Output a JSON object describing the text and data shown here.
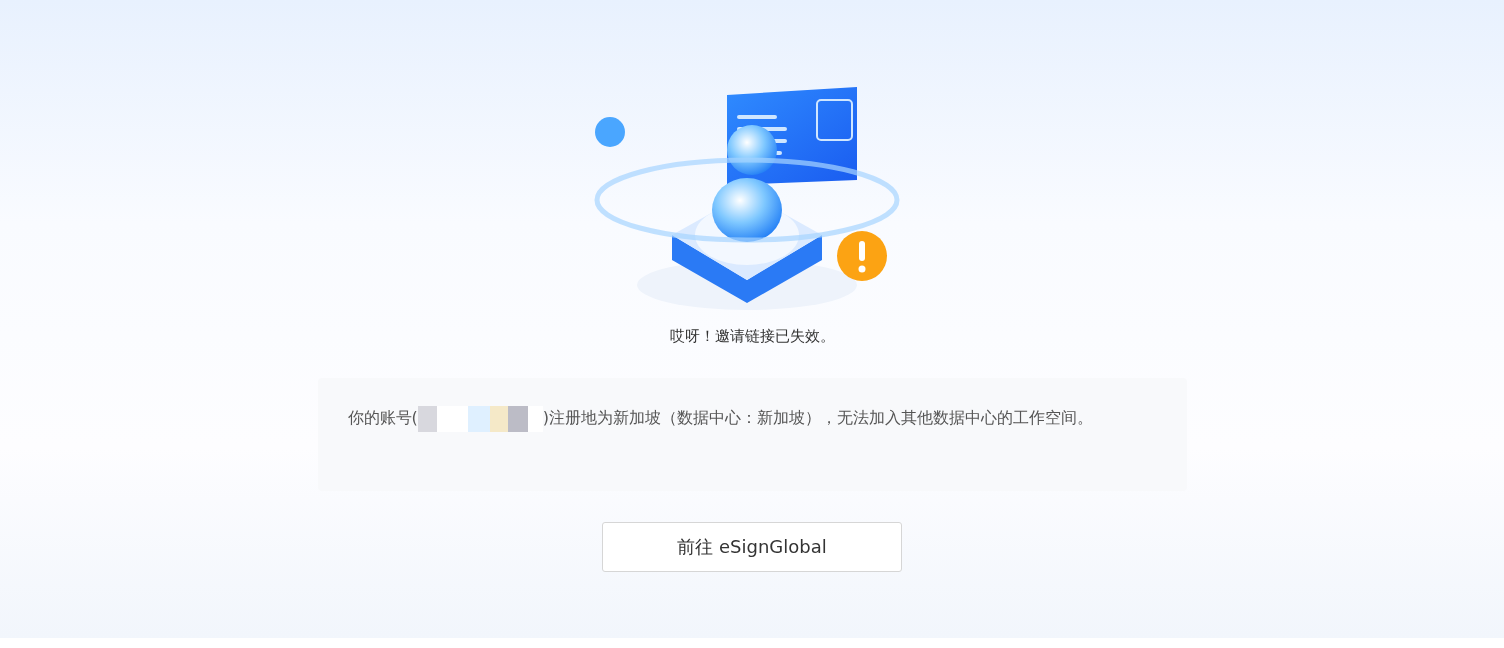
{
  "title": "哎呀！邀请链接已失效。",
  "notice": {
    "before": "你的账号(",
    "after": ")注册地为新加坡（数据中心：新加坡），无法加入其他数据中心的工作空间。"
  },
  "button": {
    "label": "前往 eSignGlobal"
  }
}
